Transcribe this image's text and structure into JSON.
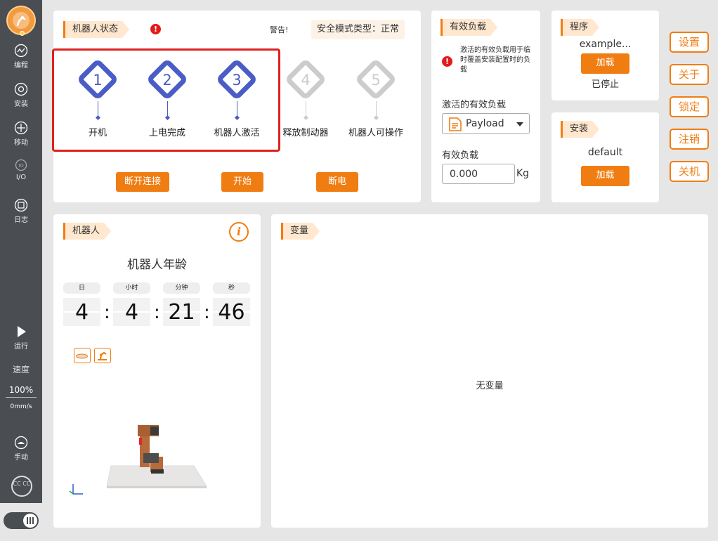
{
  "sidebar": {
    "items": [
      {
        "label": "编程",
        "icon": "wave-icon"
      },
      {
        "label": "安装",
        "icon": "gear-icon"
      },
      {
        "label": "移动",
        "icon": "move-icon"
      },
      {
        "label": "I/O",
        "icon": "io-icon"
      },
      {
        "label": "日志",
        "icon": "log-icon"
      }
    ],
    "run_label": "运行",
    "speed_label": "速度",
    "speed_percent": "100%",
    "speed_mm": "0mm/s",
    "manual_label": "手动",
    "cc_label": "CC CC"
  },
  "robot_status": {
    "title": "机器人状态",
    "warning_label": "警告!",
    "safety_mode": "安全模式类型：正常",
    "steps": [
      {
        "num": "1",
        "label": "开机",
        "active": true
      },
      {
        "num": "2",
        "label": "上电完成",
        "active": true
      },
      {
        "num": "3",
        "label": "机器人激活",
        "active": true
      },
      {
        "num": "4",
        "label": "释放制动器",
        "active": false
      },
      {
        "num": "5",
        "label": "机器人可操作",
        "active": false
      }
    ],
    "buttons": {
      "disconnect": "断开连接",
      "start": "开始",
      "power_off": "断电"
    }
  },
  "payload": {
    "title": "有效负载",
    "note": "激活的有效负载用于临时覆盖安装配置时的负载",
    "active_label": "激活的有效负载",
    "selected": "Payload",
    "load_label": "有效负载",
    "load_value": "0.000",
    "unit": "Kg"
  },
  "program": {
    "title": "程序",
    "name": "example...",
    "load_button": "加载",
    "status": "已停止"
  },
  "install": {
    "title": "安装",
    "name": "default",
    "load_button": "加载"
  },
  "side_buttons": [
    "设置",
    "关于",
    "锁定",
    "注销",
    "关机"
  ],
  "robot": {
    "title": "机器人",
    "age_title": "机器人年龄",
    "units": [
      "日",
      "小时",
      "分钟",
      "秒"
    ],
    "values": [
      "4",
      "4",
      "21",
      "46"
    ]
  },
  "variables": {
    "title": "变量",
    "empty": "无变量"
  },
  "colors": {
    "accent": "#f07d12",
    "step_active": "#4a5cc6",
    "step_inactive": "#cccccc",
    "highlight_box": "#e0201c"
  }
}
